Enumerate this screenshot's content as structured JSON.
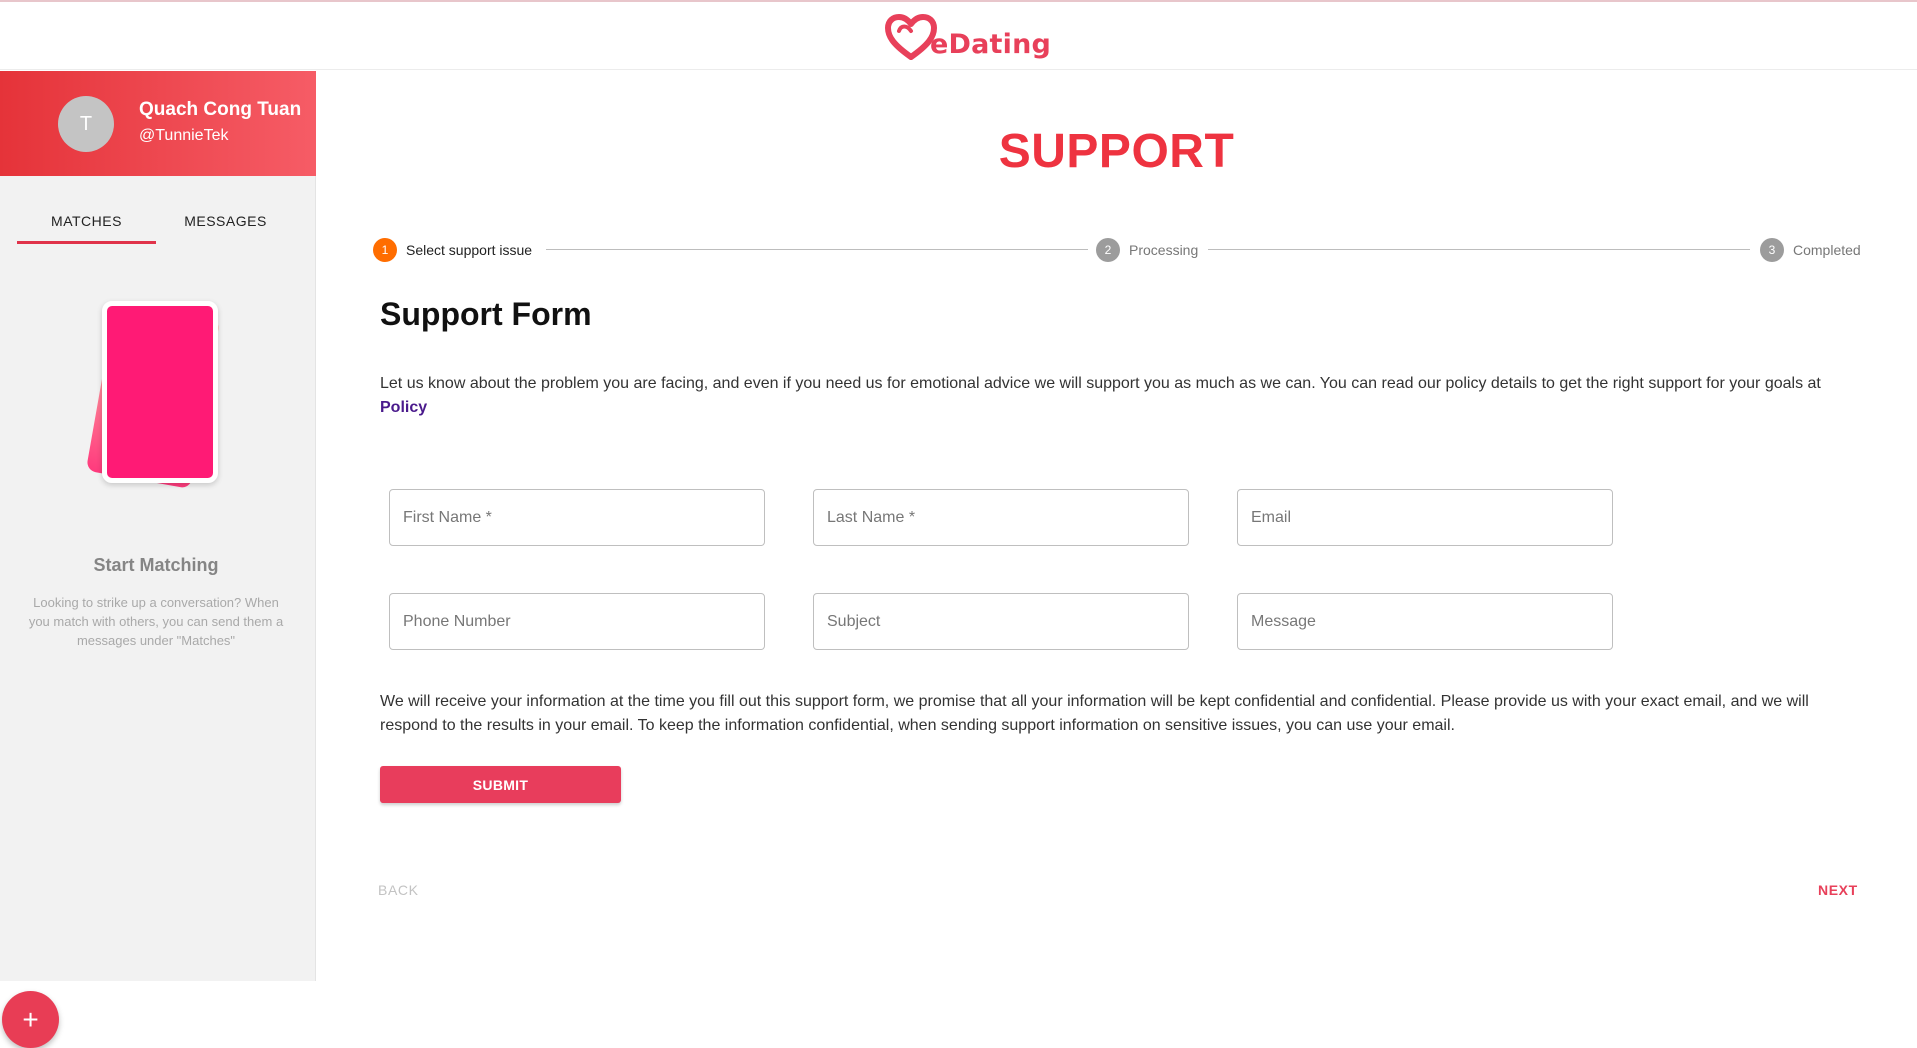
{
  "header": {
    "logo_text": "eDating",
    "brand_color": "#e8405a"
  },
  "sidebar": {
    "profile": {
      "avatar_initial": "T",
      "name": "Quach Cong Tuan",
      "handle": "@TunnieTek"
    },
    "tabs": [
      {
        "label": "MATCHES",
        "active": true
      },
      {
        "label": "MESSAGES",
        "active": false
      }
    ],
    "empty_state": {
      "title": "Start Matching",
      "description": "Looking to strike up a conversation? When you match with others, you can send them a messages under \"Matches\""
    },
    "fab_label": "+"
  },
  "main": {
    "title": "SUPPORT",
    "steps": [
      {
        "num": "1",
        "label": "Select support issue",
        "active": true
      },
      {
        "num": "2",
        "label": "Processing",
        "active": false
      },
      {
        "num": "3",
        "label": "Completed",
        "active": false
      }
    ],
    "form_title": "Support Form",
    "intro_text": "Let us know about the problem you are facing, and even if you need us for emotional advice we will support you as much as we can. You can read our policy details to get the right support for your goals at",
    "intro_link": "Policy",
    "fields": {
      "first_name": "First Name *",
      "last_name": "Last Name *",
      "email": "Email",
      "phone": "Phone Number",
      "subject": "Subject",
      "message": "Message"
    },
    "notice": "We will receive your information at the time you fill out this support form, we promise that all your information will be kept confidential and confidential. Please provide us with your exact email, and we will respond to the results in your email. To keep the information confidential, when sending support information on sensitive issues, you can use your email.",
    "submit_label": "SUBMIT",
    "back_label": "BACK",
    "next_label": "NEXT"
  }
}
